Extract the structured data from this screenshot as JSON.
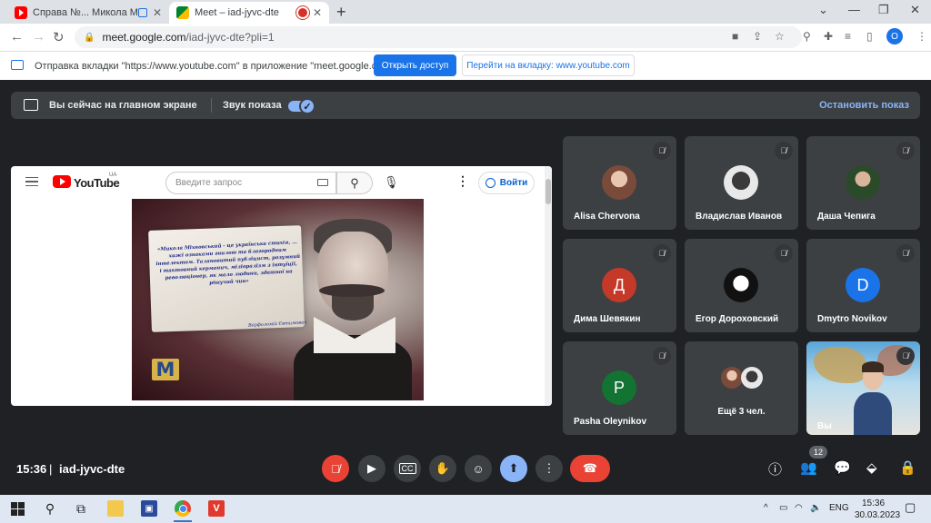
{
  "browser": {
    "tabs": [
      {
        "title": "Справа №... Микола Міхнов"
      },
      {
        "title": "Meet – iad-jyvc-dte"
      }
    ],
    "url_host": "meet.google.com",
    "url_path": "/iad-jyvc-dte?pli=1",
    "profile_initial": "O"
  },
  "infobar": {
    "message": "Отправка вкладки \"https://www.youtube.com\" в приложение \"meet.google.com\"...",
    "share_button": "Открыть доступ",
    "goto_button": "Перейти на вкладку: www.youtube.com"
  },
  "presenting": {
    "status": "Вы сейчас на главном экране",
    "sound_label": "Звук показа",
    "stop_label": "Остановить показ"
  },
  "youtube": {
    "logo_text": "YouTube",
    "region": "UA",
    "search_placeholder": "Введите запрос",
    "signin_label": "Войти",
    "quote_text": "«Микола Міхновський - це українська стихія, ... хижі ознаками гнилою та благородним інтелектом. Талановитий публіцист, розумний і тактовний керманич, міліоралізм з інтуїції, революціонер, як мало людини, здатної на рішучий чин»",
    "quote_author": "Варфоломій Євтимович",
    "channel_logo": "M"
  },
  "participants": [
    {
      "name": "Alisa Chervona",
      "avatar": "photo"
    },
    {
      "name": "Владислав Иванов",
      "avatar": "photo"
    },
    {
      "name": "Даша Чепига",
      "avatar": "photo"
    },
    {
      "name": "Дима Шевякин",
      "avatar": "Д"
    },
    {
      "name": "Егор Дороховский",
      "avatar": "photo"
    },
    {
      "name": "Dmytro Novikov",
      "avatar": "D"
    },
    {
      "name": "Pasha Oleynikov",
      "avatar": "P"
    },
    {
      "name": "Ещё 3 чел.",
      "avatar": "group"
    },
    {
      "name": "Вы",
      "avatar": "video"
    }
  ],
  "meeting": {
    "time": "15:36",
    "separator": "|",
    "code": "iad-jyvc-dte",
    "participant_count": "12"
  },
  "taskbar": {
    "language": "ENG",
    "clock_time": "15:36",
    "clock_date": "30.03.2023"
  },
  "colors": {
    "meet_background": "#202124",
    "tile_background": "#3c4043",
    "accent_blue": "#8ab4f8",
    "danger_red": "#ea4335",
    "chrome_blue": "#1a73e8"
  }
}
